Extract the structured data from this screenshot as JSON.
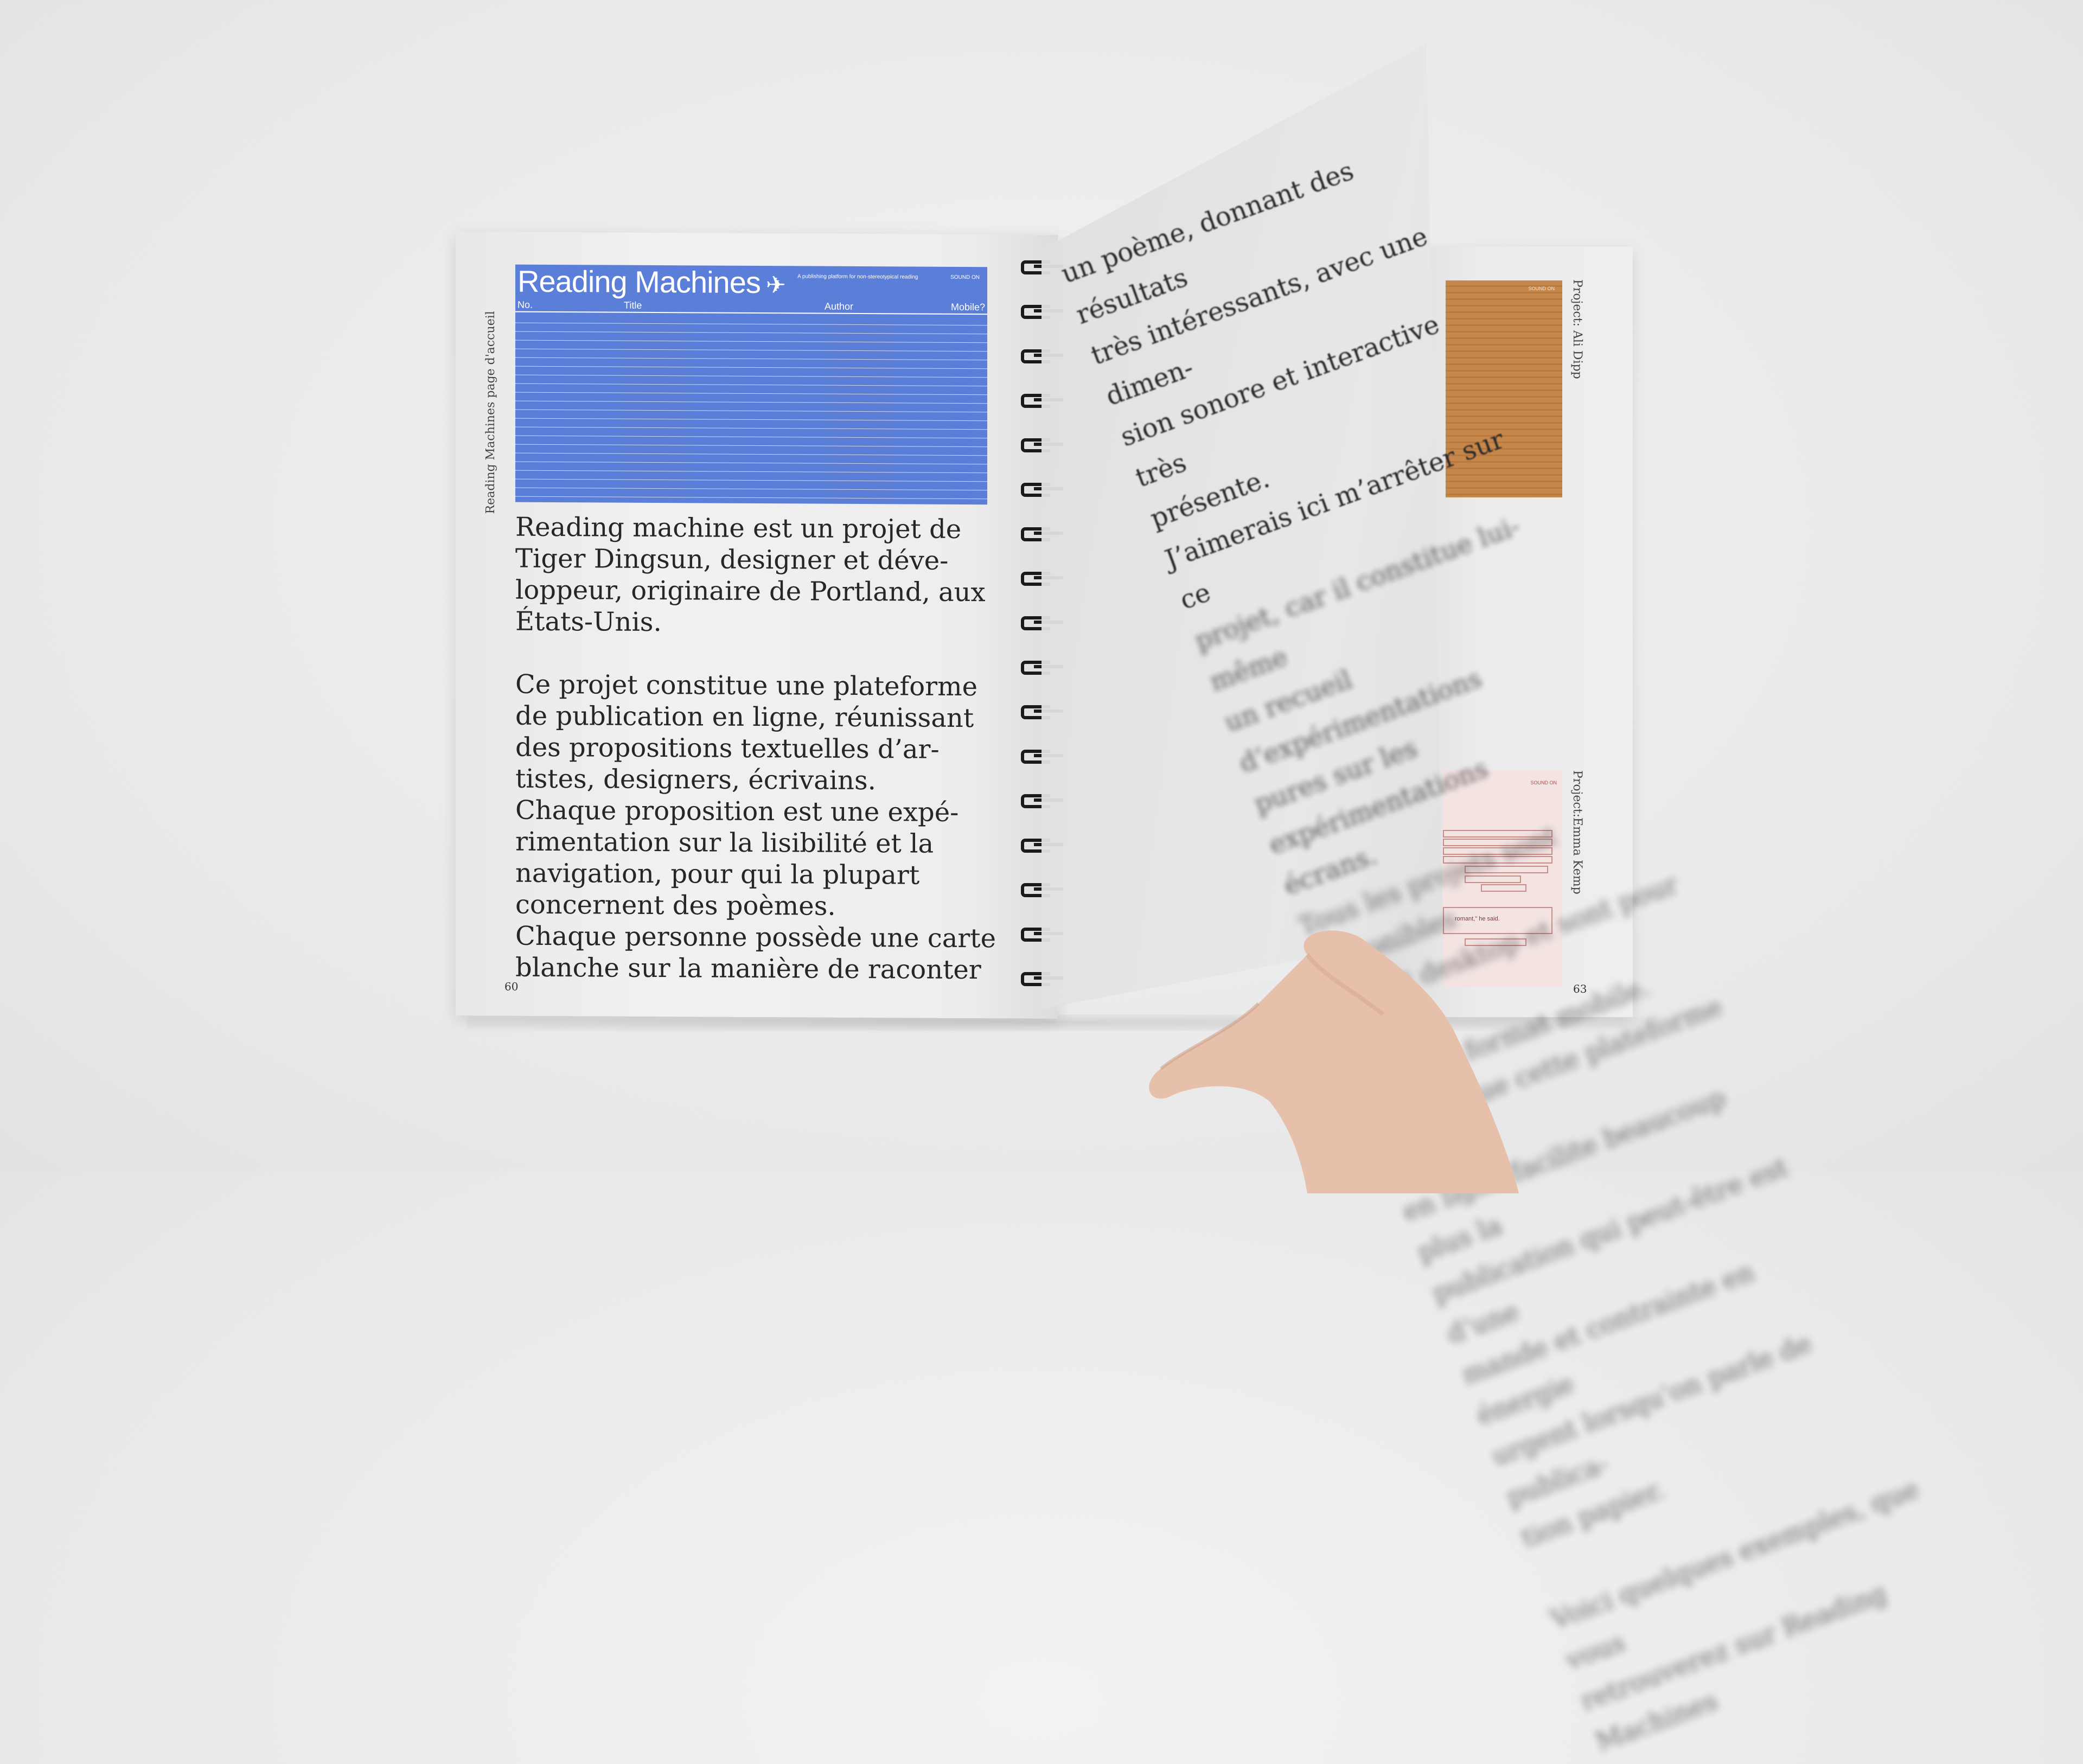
{
  "left_page": {
    "screenshot": {
      "title": "Reading Machines",
      "tagline": "A publishing platform for non-stereotypical reading",
      "sound": "SOUND ON",
      "columns": {
        "no": "No.",
        "title": "Title",
        "author": "Author",
        "mobile": "Mobile?"
      }
    },
    "vertical_label": "Reading Machines page d'accueil",
    "paragraphs": [
      "Reading machine est un projet de Tiger Dingsun, designer et déve-loppeur, originaire de Portland, aux États-Unis.",
      "Ce projet constitue une plateforme de publication en ligne, réunissant des propositions textuelles d’ar-tistes, designers, écrivains.",
      "Chaque proposition est une expé-rimentation sur la lisibilité et la navigation, pour qui la plupart concernent des poèmes.",
      "Chaque personne possède une carte blanche sur la manière de raconter"
    ],
    "page_number": "60"
  },
  "turning_page": {
    "lines": [
      "un poème, donnant des résultats",
      "très intéressants, avec une dimen-",
      "sion sonore et interactive très",
      "présente.",
      "J’aimerais ici m’arrêter sur ce",
      "projet, car il constitue lui-même",
      "un recueil d’expérimentations",
      "pures sur les expérimentations",
      "écrans.",
      "Tous les projets sont disponibles",
      "format desktop et sont pour cer-",
      "tains au format mobile.",
      "Le fait que cette plateforme soit",
      "en ligne facilite beaucoup plus la",
      "publication qui peut-être est d’une",
      "mande et contrainte en énergie",
      "urgent lorsqu’on parle de publica-",
      "tion papier.",
      "Voici quelques exemples, que vous",
      "retrouverez sur Reading Machines"
    ]
  },
  "right_page": {
    "label_top": "Project: Ali Dipp",
    "label_bottom": "Project:Emma Kemp",
    "orange_caption": "SOUND ON",
    "pink_caption": "SOUND ON",
    "pink_quote": "romant,\" he said.",
    "page_number": "63"
  }
}
